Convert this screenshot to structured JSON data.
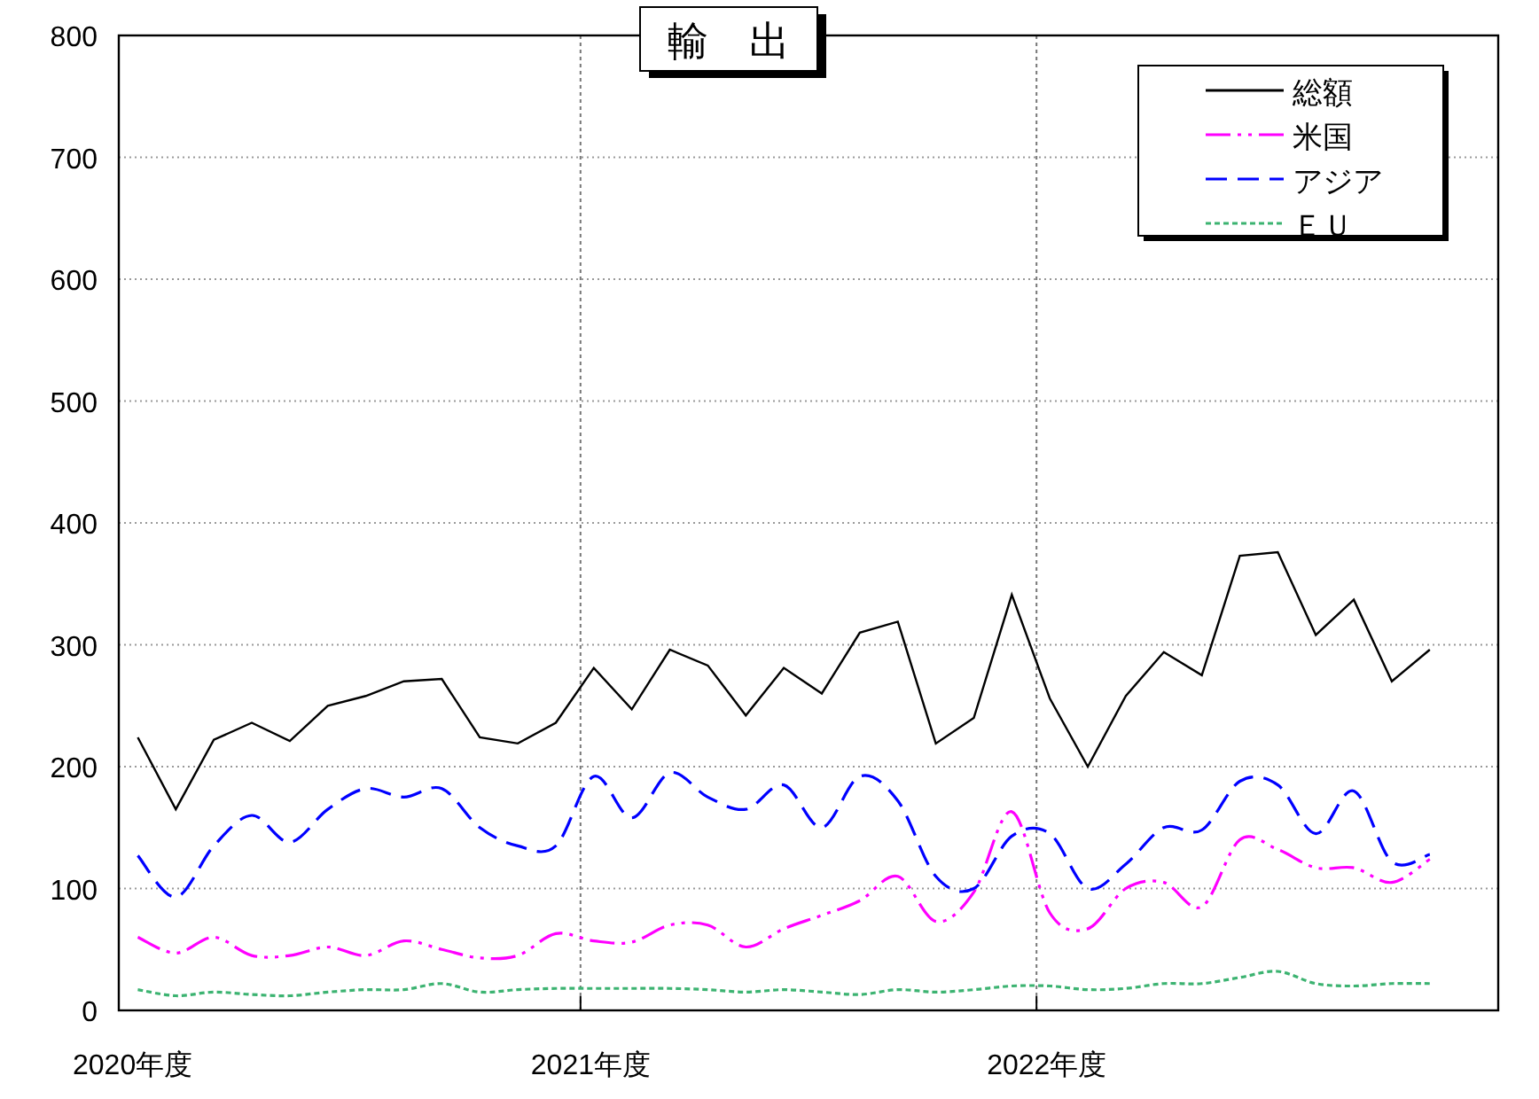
{
  "chart_data": {
    "type": "line",
    "title": "輸　出",
    "categories": [
      "2020年度",
      null,
      null,
      null,
      null,
      null,
      null,
      null,
      null,
      null,
      null,
      null,
      "2021年度",
      null,
      null,
      null,
      null,
      null,
      null,
      null,
      null,
      null,
      null,
      null,
      "2022年度",
      null,
      null,
      null,
      null,
      null,
      null,
      null,
      null,
      null,
      null
    ],
    "grid": true,
    "legend": true,
    "ylim": [
      0,
      800
    ],
    "yticks": [
      0,
      100,
      200,
      300,
      400,
      500,
      600,
      700,
      800
    ],
    "series": [
      {
        "name": "総額",
        "color": "#000000",
        "line_style": "solid",
        "values": [
          224,
          165,
          222,
          236,
          221,
          250,
          258,
          270,
          272,
          224,
          219,
          236,
          281,
          247,
          296,
          283,
          242,
          281,
          260,
          310,
          319,
          219,
          240,
          341,
          256,
          200,
          258,
          294,
          275,
          373,
          376,
          308,
          337,
          270,
          296
        ]
      },
      {
        "name": "米国",
        "color": "#ff00ff",
        "line_style": "dashdot",
        "values": [
          60,
          47,
          60,
          45,
          45,
          52,
          45,
          57,
          50,
          43,
          45,
          63,
          57,
          56,
          70,
          70,
          52,
          67,
          78,
          90,
          110,
          73,
          97,
          163,
          80,
          67,
          100,
          105,
          85,
          140,
          132,
          117,
          117,
          105,
          124
        ]
      },
      {
        "name": "アジア",
        "color": "#0000ff",
        "line_style": "dash",
        "values": [
          127,
          93,
          135,
          160,
          138,
          165,
          182,
          175,
          182,
          150,
          135,
          135,
          192,
          158,
          195,
          175,
          165,
          185,
          150,
          192,
          172,
          110,
          100,
          143,
          145,
          100,
          120,
          150,
          148,
          188,
          185,
          145,
          180,
          122,
          128
        ]
      },
      {
        "name": "ＥＵ",
        "color": "#3cb371",
        "line_style": "dot",
        "values": [
          17,
          12,
          15,
          13,
          12,
          15,
          17,
          17,
          22,
          15,
          17,
          18,
          18,
          18,
          18,
          17,
          15,
          17,
          15,
          13,
          17,
          15,
          17,
          20,
          20,
          17,
          18,
          22,
          22,
          27,
          32,
          22,
          20,
          22,
          22
        ]
      }
    ]
  }
}
